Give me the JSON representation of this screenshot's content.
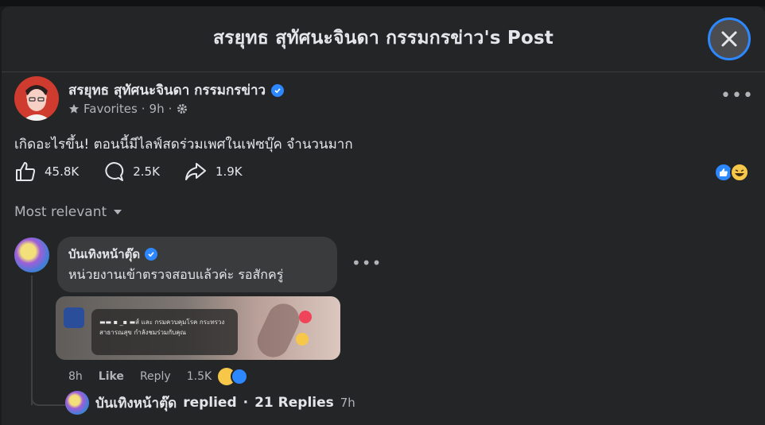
{
  "modal": {
    "title": "สรยุทธ สุทัศนะจินดา กรรมกรข่าว's Post",
    "close_icon": "close-icon"
  },
  "post": {
    "author": "สรยุทธ สุทัศนะจินดา กรรมกรข่าว",
    "audience": "Favorites",
    "time": "9h",
    "text": "เกิดอะไรขึ้น! ตอนนี้มีไลฟ์สดร่วมเพศในเฟซบุ๊ค จำนวนมาก",
    "likes": "45.8K",
    "comments": "2.5K",
    "shares": "1.9K",
    "reactions": [
      "like",
      "haha"
    ]
  },
  "sort": {
    "label": "Most relevant"
  },
  "comment": {
    "author": "บันเทิงหน้าตุ๊ด",
    "text": "หน่วยงานเข้าตรวจสอบแล้วค่ะ รอสักครู่",
    "attachment_text": "▬▬ ▪ _▪ ▬ส์ และ กรมควบคุมโรค กระทรวงสาธารณสุข กำลังชมร่วมกับคุณ",
    "time": "8h",
    "like_label": "Like",
    "reply_label": "Reply",
    "reaction_count": "1.5K",
    "reactions": [
      "haha",
      "like"
    ]
  },
  "replies": {
    "author": "บันเทิงหน้าตุ๊ด",
    "action": "replied",
    "sep": "·",
    "count_label": "21 Replies",
    "time": "7h"
  },
  "colors": {
    "accent": "#2d88ff",
    "background": "#242526",
    "bubble": "#3a3b3c"
  }
}
